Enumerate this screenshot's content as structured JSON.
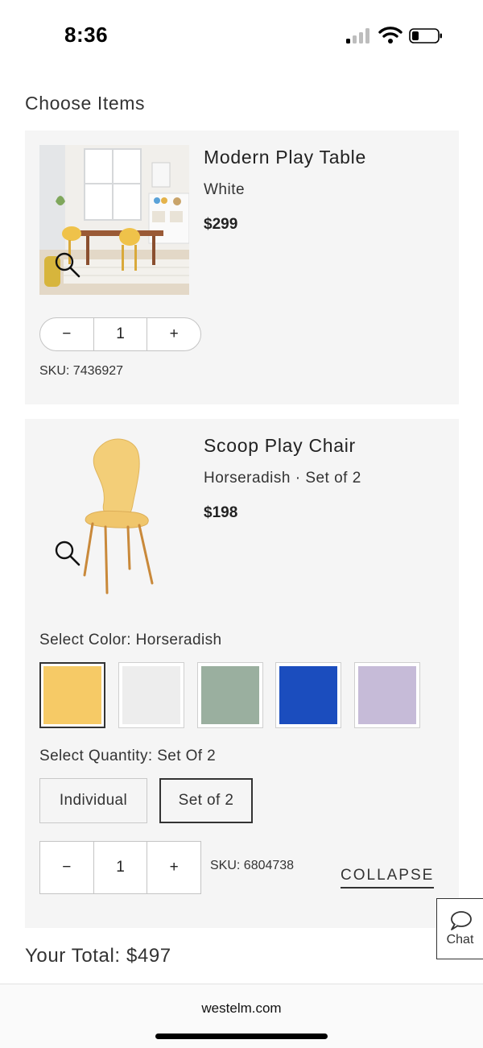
{
  "status_bar": {
    "time": "8:36"
  },
  "page": {
    "title": "Choose Items"
  },
  "items": [
    {
      "name": "Modern Play Table",
      "variant": "White",
      "price": "$299",
      "quantity": "1",
      "sku": "SKU: 7436927",
      "icons": {
        "zoom": "magnifier-icon"
      }
    },
    {
      "name": "Scoop Play Chair",
      "variant": "Horseradish · Set of 2",
      "price": "$198",
      "quantity": "1",
      "sku": "SKU: 6804738",
      "color_label": "Select Color: Horseradish",
      "colors": [
        "#F6CA66",
        "#EDEDED",
        "#9AAF9F",
        "#1B4DBE",
        "#C6BBD8"
      ],
      "quantity_label": "Select Quantity: Set Of 2",
      "quantity_options": [
        "Individual",
        "Set of 2"
      ],
      "collapse_label": "COLLAPSE"
    }
  ],
  "stepper": {
    "minus": "−",
    "plus": "+"
  },
  "chat": {
    "label": "Chat"
  },
  "total": "Your Total: $497",
  "browser": {
    "url": "westelm.com"
  }
}
